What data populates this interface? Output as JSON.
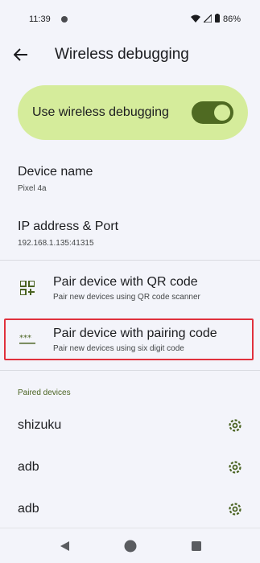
{
  "status_bar": {
    "time": "11:39",
    "battery": "86%"
  },
  "app_bar": {
    "title": "Wireless debugging"
  },
  "toggle": {
    "label": "Use wireless debugging",
    "on": true
  },
  "device": {
    "title": "Device name",
    "value": "Pixel 4a"
  },
  "ip": {
    "title": "IP address & Port",
    "value": "192.168.1.135:41315"
  },
  "actions": [
    {
      "title": "Pair device with QR code",
      "subtitle": "Pair new devices using QR code scanner",
      "icon": "qr-code-icon"
    },
    {
      "title": "Pair device with pairing code",
      "subtitle": "Pair new devices using six digit code",
      "icon": "password-icon"
    }
  ],
  "paired": {
    "header": "Paired devices",
    "items": [
      {
        "name": "shizuku",
        "icon": "gear-icon"
      },
      {
        "name": "adb",
        "icon": "gear-icon"
      },
      {
        "name": "adb",
        "icon": "gear-icon"
      }
    ]
  },
  "colors": {
    "background": "#f3f4fa",
    "toggle_card": "#d5ec9b",
    "switch_track": "#4f6a22",
    "accent": "#4a6321",
    "highlight_border": "#e0313d"
  }
}
